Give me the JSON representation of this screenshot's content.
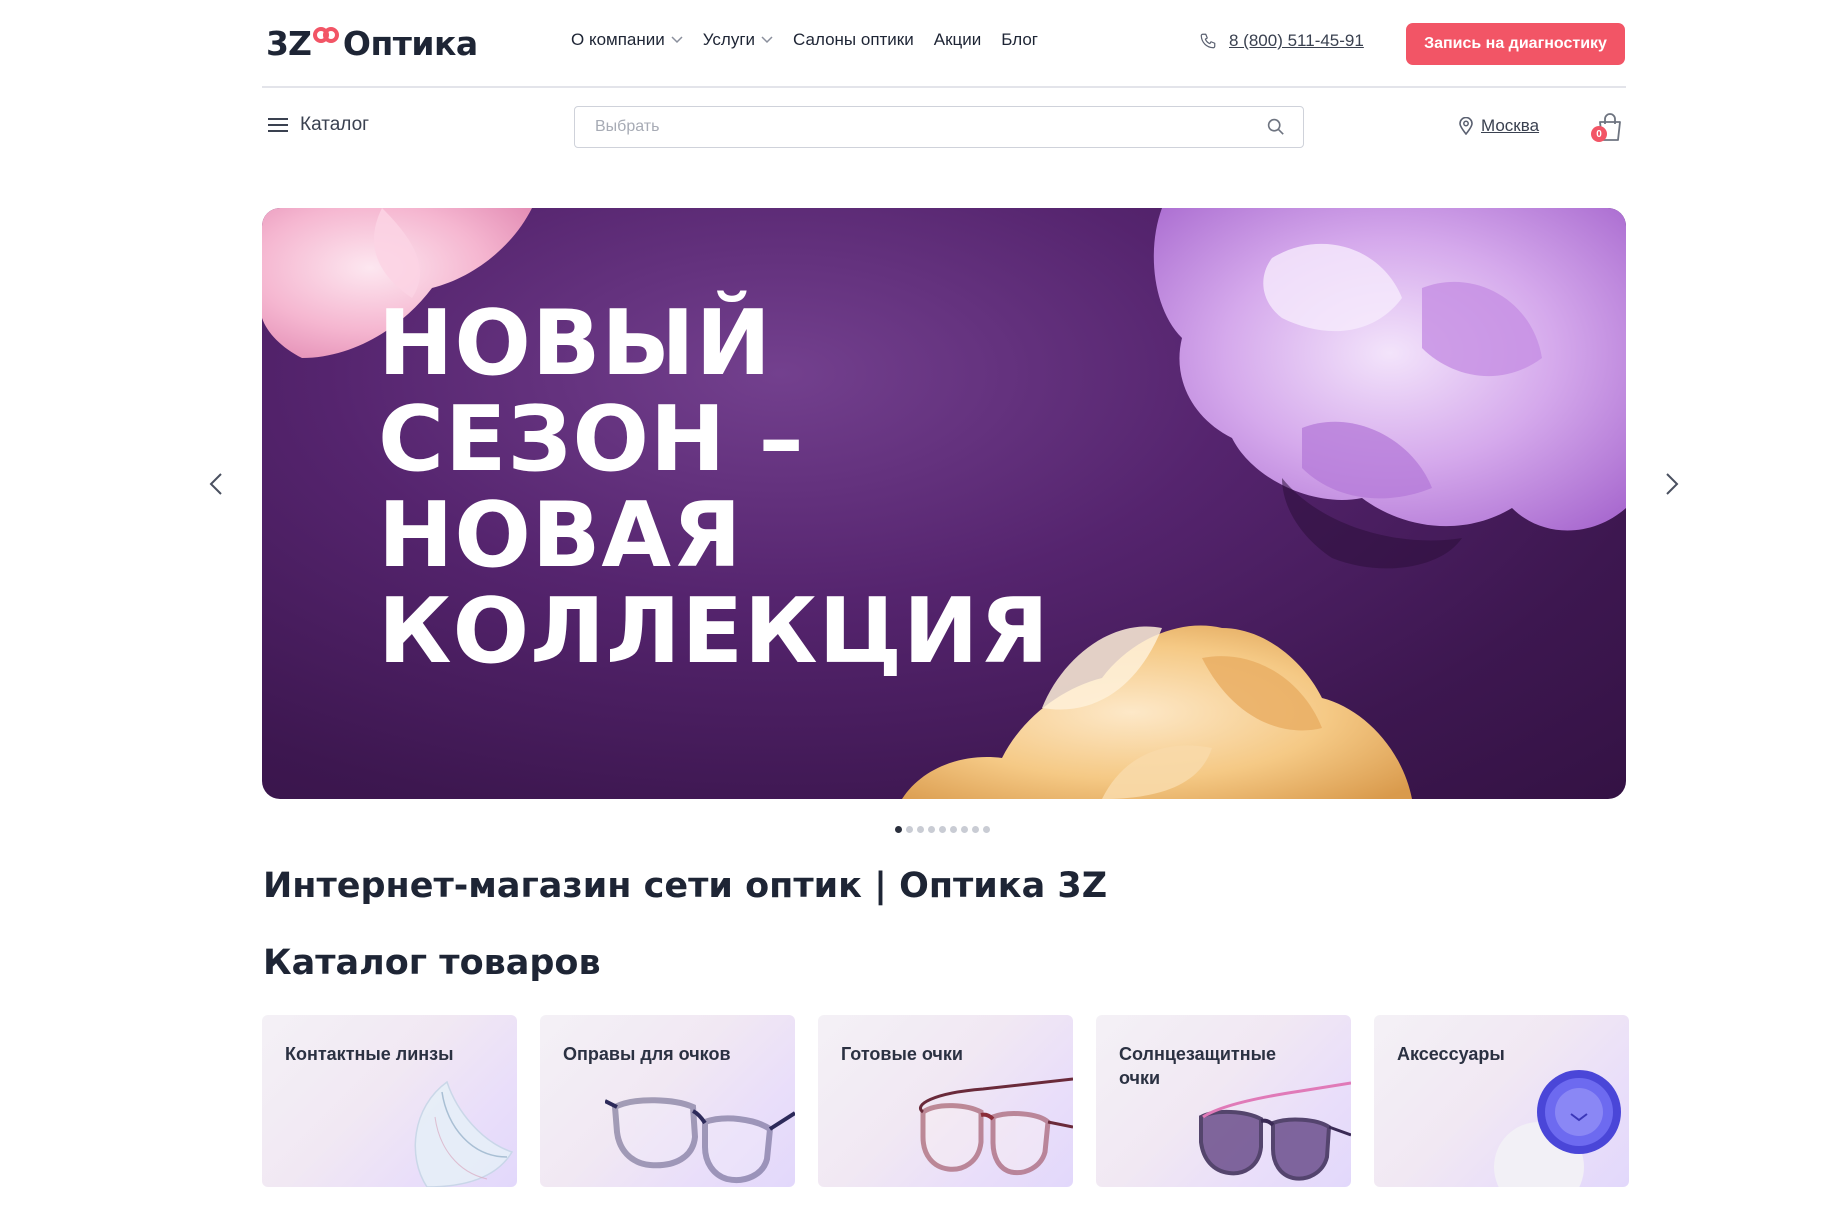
{
  "header": {
    "logo": {
      "prefix": "3Z",
      "name": "Оптика"
    },
    "nav": [
      {
        "label": "О компании",
        "has_dropdown": true
      },
      {
        "label": "Услуги",
        "has_dropdown": true
      },
      {
        "label": "Салоны оптики",
        "has_dropdown": false
      },
      {
        "label": "Акции",
        "has_dropdown": false
      },
      {
        "label": "Блог",
        "has_dropdown": false
      }
    ],
    "phone": "8 (800) 511-45-91",
    "cta_label": "Запись на диагностику",
    "accent_color": "#f25566"
  },
  "subheader": {
    "catalog_label": "Каталог",
    "search_placeholder": "Выбрать",
    "city": "Москва",
    "cart_count": "0"
  },
  "banner": {
    "title": "НОВЫЙ\nСЕЗОН –\nНОВАЯ\nКОЛЛЕКЦИЯ",
    "slides_total": 9,
    "active_slide": 1
  },
  "page": {
    "title": "Интернет-магазин сети оптик | Оптика 3Z",
    "catalog_heading": "Каталог товаров"
  },
  "catalog_cards": [
    {
      "label": "Контактные линзы",
      "icon": "contact-lens-icon"
    },
    {
      "label": "Оправы для очков",
      "icon": "frames-icon"
    },
    {
      "label": "Готовые очки",
      "icon": "glasses-icon"
    },
    {
      "label": "Солнцезащитные очки",
      "icon": "sunglasses-icon"
    },
    {
      "label": "Аксессуары",
      "icon": "lens-case-icon"
    }
  ]
}
